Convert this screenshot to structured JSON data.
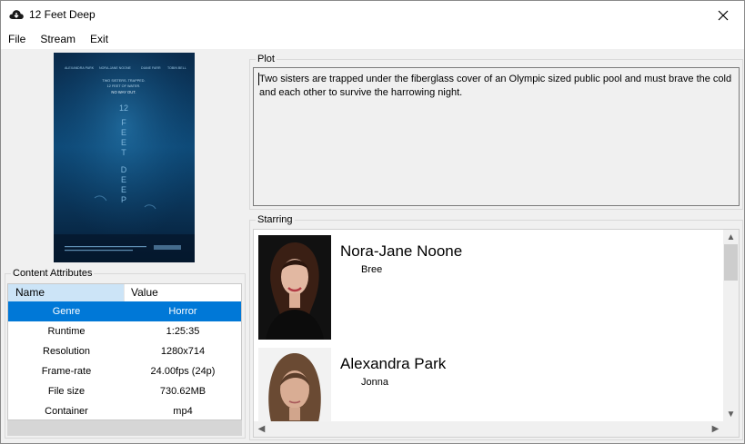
{
  "window": {
    "title": "12 Feet Deep"
  },
  "menu": {
    "items": [
      "File",
      "Stream",
      "Exit"
    ]
  },
  "poster": {
    "credits": [
      "ALEXANDRA PARK",
      "NORA-JANE NOONE",
      "DIANE FARR",
      "TOBIN BELL"
    ],
    "tagline": [
      "TWO SISTERS. TRAPPED.",
      "12 FEET OF WATER.",
      "NO WAY OUT."
    ],
    "title_word": "12",
    "title_letters": [
      "F",
      "E",
      "E",
      "T",
      "D",
      "E",
      "E",
      "P"
    ]
  },
  "attributes": {
    "label": "Content Attributes",
    "col_name": "Name",
    "col_value": "Value",
    "rows": [
      {
        "name": "Genre",
        "value": "Horror"
      },
      {
        "name": "Runtime",
        "value": "1:25:35"
      },
      {
        "name": "Resolution",
        "value": "1280x714"
      },
      {
        "name": "Frame-rate",
        "value": "24.00fps (24p)"
      },
      {
        "name": "File size",
        "value": "730.62MB"
      },
      {
        "name": "Container",
        "value": "mp4"
      }
    ]
  },
  "plot": {
    "label": "Plot",
    "text": "Two sisters are trapped under the fiberglass cover of an Olympic sized public pool and must brave the cold and each other to survive the harrowing night."
  },
  "starring": {
    "label": "Starring",
    "actors": [
      {
        "name": "Nora-Jane Noone",
        "role": "Bree"
      },
      {
        "name": "Alexandra Park",
        "role": "Jonna"
      }
    ]
  },
  "colors": {
    "selection": "#0078d7",
    "header_highlight": "#cce4f7"
  }
}
